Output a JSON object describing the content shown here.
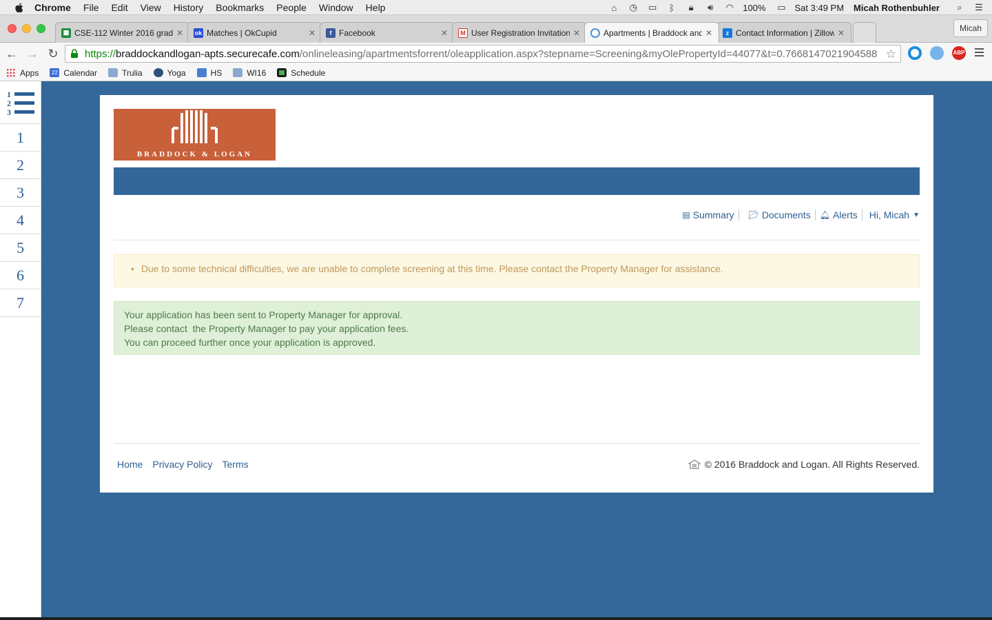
{
  "menubar": {
    "app": "Chrome",
    "items": [
      "File",
      "Edit",
      "View",
      "History",
      "Bookmarks",
      "People",
      "Window",
      "Help"
    ],
    "battery": "100%",
    "clock": "Sat 3:49 PM",
    "user": "Micah Rothenbuhler"
  },
  "tabs": [
    {
      "title": "CSE-112 Winter 2016 grad",
      "favicon": "sheets-icon",
      "color": "#1e8e3e"
    },
    {
      "title": "Matches | OkCupid",
      "favicon": "okcupid-icon",
      "color": "#2a4cd6"
    },
    {
      "title": "Facebook",
      "favicon": "facebook-icon",
      "color": "#3b5998"
    },
    {
      "title": "User Registration Invitation",
      "favicon": "gmail-icon",
      "color": "#d93025"
    },
    {
      "title": "Apartments | Braddock and",
      "favicon": "chrome-loading-icon",
      "color": "#4a90d9"
    },
    {
      "title": "Contact Information | Zillow",
      "favicon": "zillow-icon",
      "color": "#1277e1"
    }
  ],
  "profile_button": "Micah",
  "url": {
    "scheme": "https://",
    "host": "braddockandlogan-apts.securecafe.com",
    "path": "/onlineleasing/apartmentsforrent/oleapplication.aspx?stepname=Screening&myOlePropertyId=44077&t=0.7668147021904588"
  },
  "bookmarks": [
    {
      "label": "Apps",
      "icon": "apps-grid-icon"
    },
    {
      "label": "Calendar",
      "icon": "calendar-icon",
      "badge": "22"
    },
    {
      "label": "Trulia",
      "icon": "folder-icon"
    },
    {
      "label": "Yoga",
      "icon": "yoga-icon"
    },
    {
      "label": "HS",
      "icon": "hs-icon"
    },
    {
      "label": "WI16",
      "icon": "folder-icon"
    },
    {
      "label": "Schedule",
      "icon": "schedule-icon"
    }
  ],
  "steps": [
    "1",
    "2",
    "3",
    "4",
    "5",
    "6",
    "7"
  ],
  "logo": {
    "text": "BRADDOCK & LOGAN",
    "color": "#c8603a"
  },
  "user_nav": {
    "summary": "Summary",
    "documents": "Documents",
    "alerts": "Alerts",
    "greeting": "Hi, Micah"
  },
  "warning": "Due to some technical difficulties, we are unable to complete screening at this time. Please contact the Property Manager for assistance.",
  "success": [
    "Your application has been sent to Property Manager for approval.",
    "Please contact  the Property Manager to pay your application fees.",
    "You can proceed further once your application is approved."
  ],
  "footer": {
    "links": [
      "Home",
      "Privacy Policy",
      "Terms"
    ],
    "copyright": "© 2016 Braddock and Logan. All Rights Reserved."
  },
  "colors": {
    "page_bg": "#34679a",
    "brand_orange": "#c8603a",
    "link": "#2f5f90",
    "warning_bg": "#fcf8e3",
    "success_bg": "#dff0d8"
  }
}
